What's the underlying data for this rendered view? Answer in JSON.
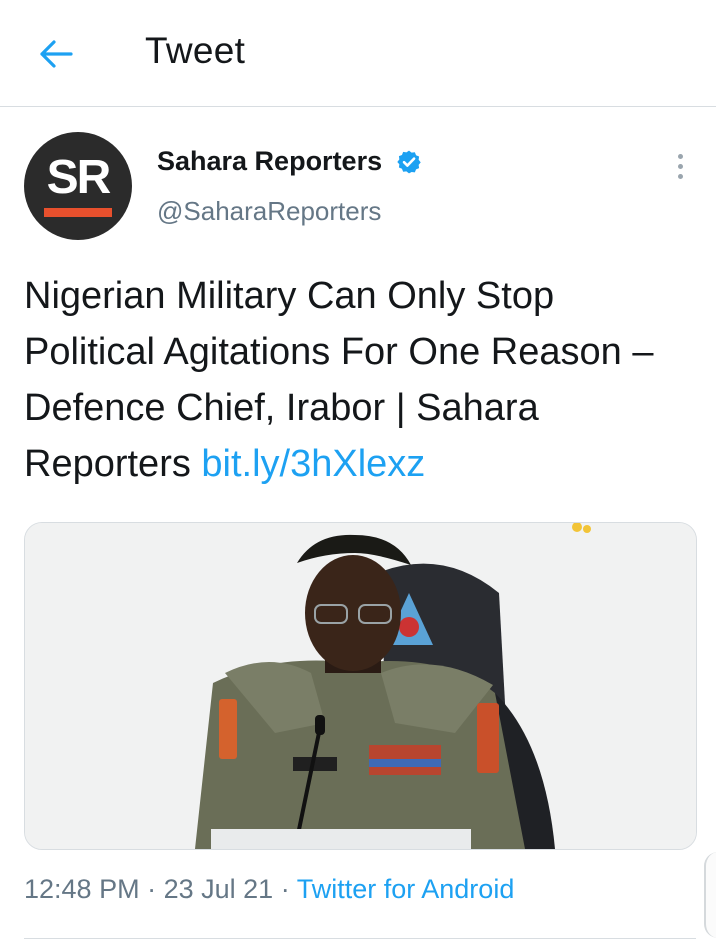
{
  "header": {
    "title": "Tweet",
    "back_icon": "arrow-left-icon",
    "accent_color": "#1da1f2"
  },
  "tweet": {
    "avatar_text": "SR",
    "avatar_colors": {
      "background": "#2b2b2b",
      "bar": "#e8502d"
    },
    "display_name": "Sahara Reporters",
    "verified": true,
    "verified_icon": "verified-badge-icon",
    "handle": "@SaharaReporters",
    "more_icon": "more-vertical-icon",
    "text": "Nigerian Military Can Only Stop Political Agitations For One Reason – Defence Chief, Irabor | Sahara Reporters",
    "link": "bit.ly/3hXlexz",
    "time": "12:48 PM",
    "separator": "·",
    "date": "23 Jul 21",
    "source": "Twitter for Android"
  }
}
